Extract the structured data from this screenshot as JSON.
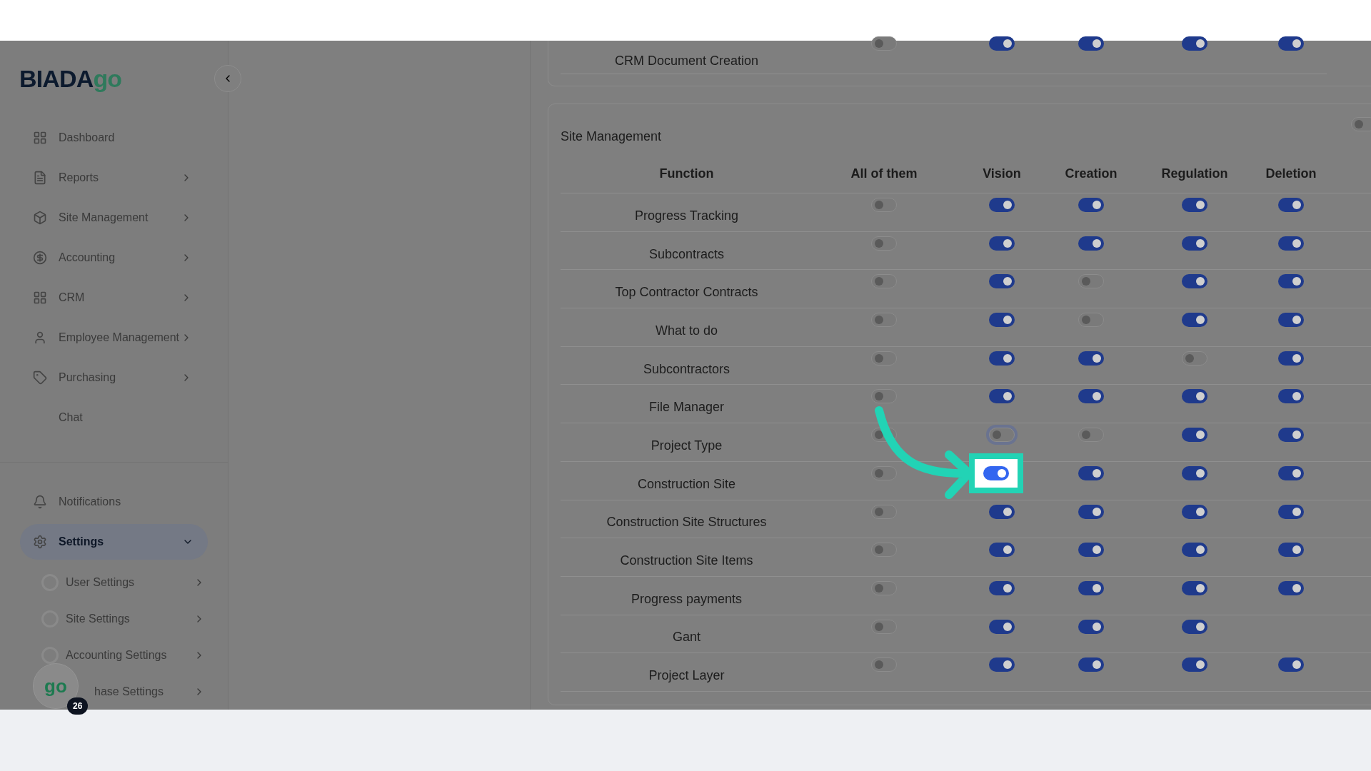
{
  "sidebar": {
    "logo": {
      "text": "BIADA",
      "accent": "go"
    },
    "items": [
      {
        "label": "Dashboard",
        "chevron": false
      },
      {
        "label": "Reports",
        "chevron": true
      },
      {
        "label": "Site Management",
        "chevron": true
      },
      {
        "label": "Accounting",
        "chevron": true
      },
      {
        "label": "CRM",
        "chevron": true
      },
      {
        "label": "Employee Management",
        "chevron": true
      },
      {
        "label": "Purchasing",
        "chevron": true
      },
      {
        "label": "Chat",
        "chevron": false
      }
    ],
    "bottom_items": [
      {
        "label": "Notifications",
        "selected": false
      },
      {
        "label": "Settings",
        "selected": true
      }
    ],
    "sub_items": [
      {
        "label": "User Settings"
      },
      {
        "label": "Site Settings"
      },
      {
        "label": "Accounting Settings"
      },
      {
        "label": "hase Settings"
      }
    ],
    "chat_bubble": {
      "logo": "go",
      "badge": "26"
    }
  },
  "previous_section": {
    "rows": [
      {
        "function": "CRM Document Creation",
        "cells": [
          {
            "kind": "toggle",
            "on": false
          },
          {
            "kind": "toggle",
            "on": true
          },
          {
            "kind": "toggle",
            "on": true
          },
          {
            "kind": "toggle",
            "on": true
          },
          {
            "kind": "toggle",
            "on": true
          }
        ]
      }
    ]
  },
  "section": {
    "title": "Site Management",
    "master_on": false,
    "columns": [
      "Function",
      "All of them",
      "Vision",
      "Creation",
      "Regulation",
      "Deletion"
    ],
    "rows": [
      {
        "function": "Progress Tracking",
        "cells": [
          {
            "kind": "toggle",
            "on": false
          },
          {
            "kind": "toggle",
            "on": true
          },
          {
            "kind": "toggle",
            "on": true
          },
          {
            "kind": "toggle",
            "on": true
          },
          {
            "kind": "toggle",
            "on": true
          }
        ]
      },
      {
        "function": "Subcontracts",
        "cells": [
          {
            "kind": "toggle",
            "on": false
          },
          {
            "kind": "toggle",
            "on": true
          },
          {
            "kind": "toggle",
            "on": true
          },
          {
            "kind": "toggle",
            "on": true
          },
          {
            "kind": "toggle",
            "on": true
          }
        ]
      },
      {
        "function": "Top Contractor Contracts",
        "cells": [
          {
            "kind": "toggle",
            "on": false
          },
          {
            "kind": "toggle",
            "on": true
          },
          {
            "kind": "toggle",
            "on": false
          },
          {
            "kind": "toggle",
            "on": true
          },
          {
            "kind": "toggle",
            "on": true
          }
        ]
      },
      {
        "function": "What to do",
        "cells": [
          {
            "kind": "toggle",
            "on": false
          },
          {
            "kind": "toggle",
            "on": true
          },
          {
            "kind": "toggle",
            "on": false
          },
          {
            "kind": "toggle",
            "on": true
          },
          {
            "kind": "toggle",
            "on": true
          }
        ]
      },
      {
        "function": "Subcontractors",
        "cells": [
          {
            "kind": "toggle",
            "on": false
          },
          {
            "kind": "toggle",
            "on": true
          },
          {
            "kind": "toggle",
            "on": true
          },
          {
            "kind": "toggle",
            "on": false
          },
          {
            "kind": "toggle",
            "on": true
          }
        ]
      },
      {
        "function": "File Manager",
        "cells": [
          {
            "kind": "toggle",
            "on": false
          },
          {
            "kind": "toggle",
            "on": true
          },
          {
            "kind": "toggle",
            "on": true
          },
          {
            "kind": "toggle",
            "on": true
          },
          {
            "kind": "toggle",
            "on": true
          }
        ]
      },
      {
        "function": "Project Type",
        "cells": [
          {
            "kind": "toggle",
            "on": false
          },
          {
            "kind": "focused",
            "on": false
          },
          {
            "kind": "toggle",
            "on": false
          },
          {
            "kind": "toggle",
            "on": true
          },
          {
            "kind": "toggle",
            "on": true
          }
        ]
      },
      {
        "function": "Construction Site",
        "cells": [
          {
            "kind": "toggle",
            "on": false
          },
          {
            "kind": "spotlight",
            "on": true
          },
          {
            "kind": "toggle",
            "on": true
          },
          {
            "kind": "toggle",
            "on": true
          },
          {
            "kind": "toggle",
            "on": true
          }
        ]
      },
      {
        "function": "Construction Site Structures",
        "cells": [
          {
            "kind": "toggle",
            "on": false
          },
          {
            "kind": "toggle",
            "on": true
          },
          {
            "kind": "toggle",
            "on": true
          },
          {
            "kind": "toggle",
            "on": true
          },
          {
            "kind": "toggle",
            "on": true
          }
        ]
      },
      {
        "function": "Construction Site Items",
        "cells": [
          {
            "kind": "toggle",
            "on": false
          },
          {
            "kind": "toggle",
            "on": true
          },
          {
            "kind": "toggle",
            "on": true
          },
          {
            "kind": "toggle",
            "on": true
          },
          {
            "kind": "toggle",
            "on": true
          }
        ]
      },
      {
        "function": "Progress payments",
        "cells": [
          {
            "kind": "toggle",
            "on": false
          },
          {
            "kind": "toggle",
            "on": true
          },
          {
            "kind": "toggle",
            "on": true
          },
          {
            "kind": "toggle",
            "on": true
          },
          {
            "kind": "toggle",
            "on": true
          }
        ]
      },
      {
        "function": "Gant",
        "cells": [
          {
            "kind": "toggle",
            "on": false
          },
          {
            "kind": "toggle",
            "on": true
          },
          {
            "kind": "toggle",
            "on": true
          },
          {
            "kind": "toggle",
            "on": true
          },
          {
            "kind": "blank"
          }
        ]
      },
      {
        "function": "Project Layer",
        "cells": [
          {
            "kind": "toggle",
            "on": false
          },
          {
            "kind": "toggle",
            "on": true
          },
          {
            "kind": "toggle",
            "on": true
          },
          {
            "kind": "toggle",
            "on": true
          },
          {
            "kind": "toggle",
            "on": true
          }
        ]
      }
    ]
  }
}
